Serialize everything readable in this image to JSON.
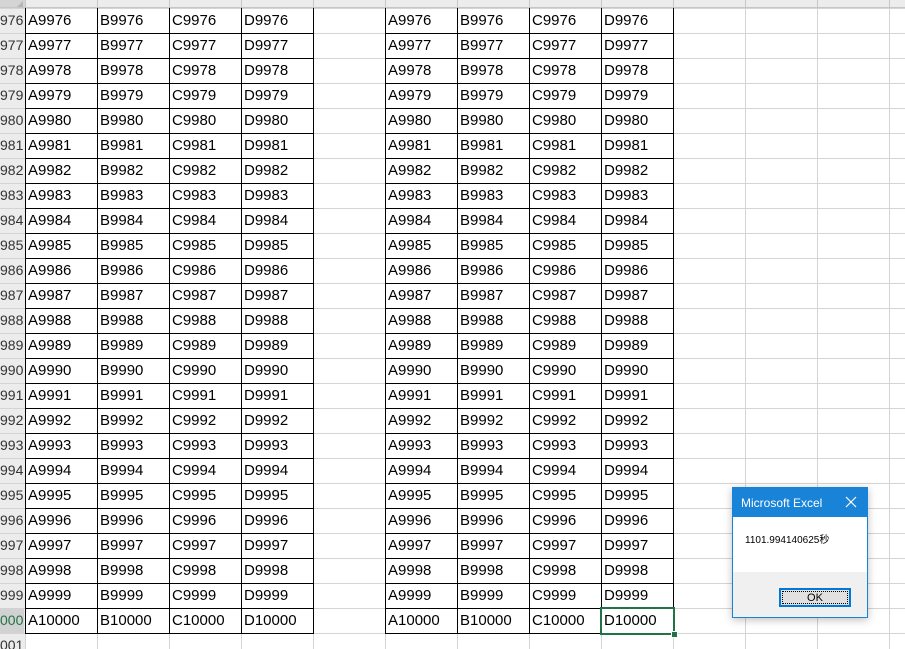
{
  "row_headers": [
    "976",
    "977",
    "978",
    "979",
    "980",
    "981",
    "982",
    "983",
    "984",
    "985",
    "986",
    "987",
    "988",
    "989",
    "990",
    "991",
    "992",
    "993",
    "994",
    "995",
    "996",
    "997",
    "998",
    "999",
    "000",
    "001"
  ],
  "left_table": [
    [
      "A9976",
      "B9976",
      "C9976",
      "D9976"
    ],
    [
      "A9977",
      "B9977",
      "C9977",
      "D9977"
    ],
    [
      "A9978",
      "B9978",
      "C9978",
      "D9978"
    ],
    [
      "A9979",
      "B9979",
      "C9979",
      "D9979"
    ],
    [
      "A9980",
      "B9980",
      "C9980",
      "D9980"
    ],
    [
      "A9981",
      "B9981",
      "C9981",
      "D9981"
    ],
    [
      "A9982",
      "B9982",
      "C9982",
      "D9982"
    ],
    [
      "A9983",
      "B9983",
      "C9983",
      "D9983"
    ],
    [
      "A9984",
      "B9984",
      "C9984",
      "D9984"
    ],
    [
      "A9985",
      "B9985",
      "C9985",
      "D9985"
    ],
    [
      "A9986",
      "B9986",
      "C9986",
      "D9986"
    ],
    [
      "A9987",
      "B9987",
      "C9987",
      "D9987"
    ],
    [
      "A9988",
      "B9988",
      "C9988",
      "D9988"
    ],
    [
      "A9989",
      "B9989",
      "C9989",
      "D9989"
    ],
    [
      "A9990",
      "B9990",
      "C9990",
      "D9990"
    ],
    [
      "A9991",
      "B9991",
      "C9991",
      "D9991"
    ],
    [
      "A9992",
      "B9992",
      "C9992",
      "D9992"
    ],
    [
      "A9993",
      "B9993",
      "C9993",
      "D9993"
    ],
    [
      "A9994",
      "B9994",
      "C9994",
      "D9994"
    ],
    [
      "A9995",
      "B9995",
      "C9995",
      "D9995"
    ],
    [
      "A9996",
      "B9996",
      "C9996",
      "D9996"
    ],
    [
      "A9997",
      "B9997",
      "C9997",
      "D9997"
    ],
    [
      "A9998",
      "B9998",
      "C9998",
      "D9998"
    ],
    [
      "A9999",
      "B9999",
      "C9999",
      "D9999"
    ],
    [
      "A10000",
      "B10000",
      "C10000",
      "D10000"
    ]
  ],
  "right_table": [
    [
      "A9976",
      "B9976",
      "C9976",
      "D9976"
    ],
    [
      "A9977",
      "B9977",
      "C9977",
      "D9977"
    ],
    [
      "A9978",
      "B9978",
      "C9978",
      "D9978"
    ],
    [
      "A9979",
      "B9979",
      "C9979",
      "D9979"
    ],
    [
      "A9980",
      "B9980",
      "C9980",
      "D9980"
    ],
    [
      "A9981",
      "B9981",
      "C9981",
      "D9981"
    ],
    [
      "A9982",
      "B9982",
      "C9982",
      "D9982"
    ],
    [
      "A9983",
      "B9983",
      "C9983",
      "D9983"
    ],
    [
      "A9984",
      "B9984",
      "C9984",
      "D9984"
    ],
    [
      "A9985",
      "B9985",
      "C9985",
      "D9985"
    ],
    [
      "A9986",
      "B9986",
      "C9986",
      "D9986"
    ],
    [
      "A9987",
      "B9987",
      "C9987",
      "D9987"
    ],
    [
      "A9988",
      "B9988",
      "C9988",
      "D9988"
    ],
    [
      "A9989",
      "B9989",
      "C9989",
      "D9989"
    ],
    [
      "A9990",
      "B9990",
      "C9990",
      "D9990"
    ],
    [
      "A9991",
      "B9991",
      "C9991",
      "D9991"
    ],
    [
      "A9992",
      "B9992",
      "C9992",
      "D9992"
    ],
    [
      "A9993",
      "B9993",
      "C9993",
      "D9993"
    ],
    [
      "A9994",
      "B9994",
      "C9994",
      "D9994"
    ],
    [
      "A9995",
      "B9995",
      "C9995",
      "D9995"
    ],
    [
      "A9996",
      "B9996",
      "C9996",
      "D9996"
    ],
    [
      "A9997",
      "B9997",
      "C9997",
      "D9997"
    ],
    [
      "A9998",
      "B9998",
      "C9998",
      "D9998"
    ],
    [
      "A9999",
      "B9999",
      "C9999",
      "D9999"
    ],
    [
      "A10000",
      "B10000",
      "C10000",
      "D10000"
    ]
  ],
  "selected_row_index": 24,
  "selected_cell": "right_table.24.3",
  "dialog": {
    "title": "Microsoft Excel",
    "message": "1101.994140625秒",
    "ok_label": "OK",
    "close_icon": "close-icon"
  },
  "colors": {
    "selection": "#217346",
    "dialog_title_bg": "#1883d7",
    "ok_border": "#0078d7"
  }
}
